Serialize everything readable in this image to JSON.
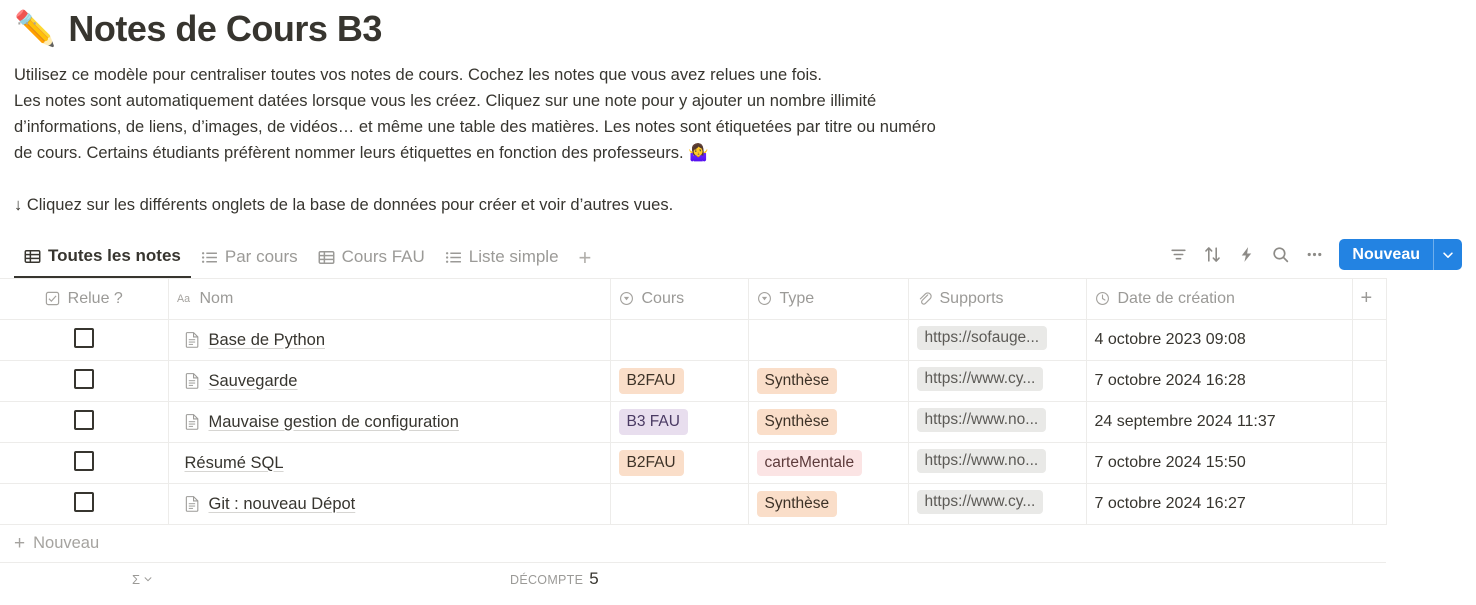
{
  "page": {
    "emoji": "✏️",
    "title": "Notes de Cours B3",
    "intro_line1": "Utilisez ce modèle pour centraliser toutes vos notes de cours. Cochez les notes que vous avez relues une fois.",
    "intro_line2": "Les notes sont automatiquement datées lorsque vous les créez. Cliquez sur une note pour y ajouter un nombre illimité",
    "intro_line3": "d’informations, de liens, d’images, de vidéos… et même une table des matières. Les notes sont étiquetées par titre ou numéro",
    "intro_line4": "de cours. Certains étudiants préfèrent nommer leurs étiquettes en fonction des professeurs. 🤷‍♀️",
    "hint_line": "↓ Cliquez sur les différents onglets de la base de données pour créer et voir d’autres vues."
  },
  "tabs": [
    {
      "label": "Toutes les notes",
      "icon": "table-icon",
      "active": true
    },
    {
      "label": "Par cours",
      "icon": "list-icon",
      "active": false
    },
    {
      "label": "Cours FAU",
      "icon": "table-icon",
      "active": false
    },
    {
      "label": "Liste simple",
      "icon": "list-icon",
      "active": false
    }
  ],
  "tab_add_label": "+",
  "toolbar": {
    "filter_icon": "filter-icon",
    "sort_icon": "sort-icon",
    "automation_icon": "lightning-icon",
    "search_icon": "search-icon",
    "more_icon": "more-options-icon",
    "new_label": "Nouveau",
    "new_caret_icon": "chevron-down-icon",
    "accent_color": "#2383e2"
  },
  "table": {
    "columns": [
      {
        "key": "relue",
        "label": "Relue ?",
        "icon": "checkbox-icon"
      },
      {
        "key": "nom",
        "label": "Nom",
        "icon": "title-aa-icon"
      },
      {
        "key": "cours",
        "label": "Cours",
        "icon": "select-icon"
      },
      {
        "key": "type",
        "label": "Type",
        "icon": "select-icon"
      },
      {
        "key": "supports",
        "label": "Supports",
        "icon": "paperclip-icon"
      },
      {
        "key": "date",
        "label": "Date de création",
        "icon": "clock-icon"
      }
    ],
    "add_column_label": "+",
    "more_columns_label": "···",
    "rows": [
      {
        "relue": false,
        "has_doc_icon": true,
        "nom": "Base de Python",
        "cours": "",
        "cours_color": "",
        "type": "",
        "type_color": "",
        "supports": "https://sofauge...",
        "date": "4 octobre 2023 09:08"
      },
      {
        "relue": false,
        "has_doc_icon": true,
        "nom": "Sauvegarde",
        "cours": "B2FAU",
        "cours_color": "#fadec9",
        "type": "Synthèse",
        "type_color": "#fadec9",
        "supports": "https://www.cy...",
        "date": "7 octobre 2024 16:28"
      },
      {
        "relue": false,
        "has_doc_icon": true,
        "nom": "Mauvaise gestion de configuration",
        "cours": "B3 FAU",
        "cours_color": "#e8deee",
        "type": "Synthèse",
        "type_color": "#fadec9",
        "supports": "https://www.no...",
        "date": "24 septembre 2024 11:37"
      },
      {
        "relue": false,
        "has_doc_icon": false,
        "nom": "Résumé SQL",
        "cours": "B2FAU",
        "cours_color": "#fadec9",
        "type": "carteMentale",
        "type_color": "#fbe4e4",
        "supports": "https://www.no...",
        "date": "7 octobre 2024 15:50"
      },
      {
        "relue": false,
        "has_doc_icon": true,
        "nom": "Git : nouveau Dépot",
        "cours": "",
        "cours_color": "",
        "type": "Synthèse",
        "type_color": "#fadec9",
        "supports": "https://www.cy...",
        "date": "7 octobre 2024 16:27"
      }
    ]
  },
  "footer": {
    "new_row_label": "Nouveau",
    "sigma_label": "Σ",
    "count_label": "DÉCOMPTE",
    "count_value": "5"
  }
}
